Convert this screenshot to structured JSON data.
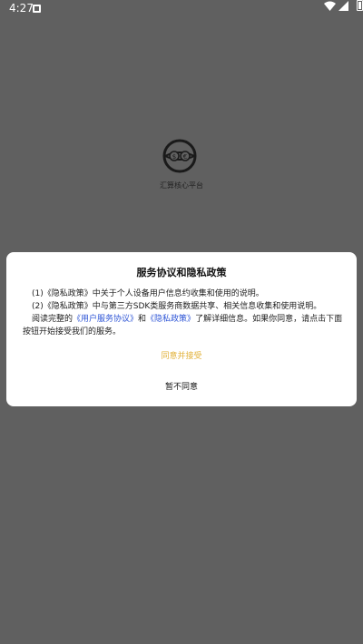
{
  "status_bar": {
    "time": "4:27",
    "icons": [
      "notification-icon",
      "wifi-icon",
      "cellular-icon",
      "battery-icon"
    ]
  },
  "splash": {
    "logo_icon": "dollar-euro-circle-logo",
    "app_name": "汇算核心平台"
  },
  "dialog": {
    "title": "服务协议和隐私政策",
    "item1": "(1)《隐私政策》中关于个人设备用户信息约收集和使用的说明。",
    "item2": "(2)《隐私政策》中与第三方SDK类服务商数据共享、相关信息收集和使用说明。",
    "para_prefix": "阅读完整的",
    "link_user_agreement": "《用户服务协议》",
    "para_and": "和",
    "link_privacy": "《隐私政策》",
    "para_suffix": "了解详细信息。如果你同意，请点击下面按钮开始接受我们的服务。",
    "accept_label": "同意并接受",
    "decline_label": "暂不同意",
    "colors": {
      "accept": "#e2b23a",
      "link": "#2f56d6",
      "overlay": "#606060"
    }
  }
}
